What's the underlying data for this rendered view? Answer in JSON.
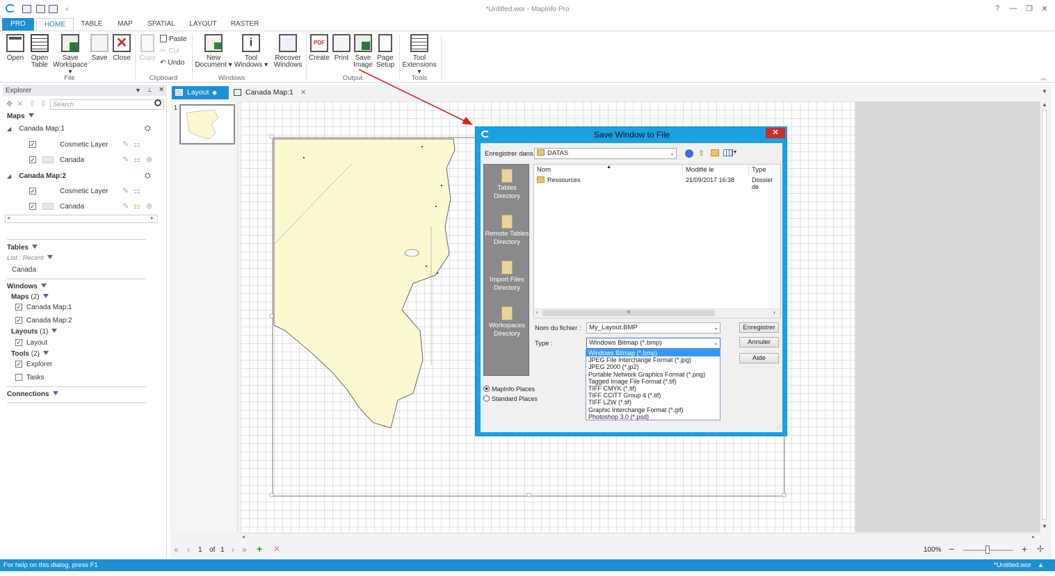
{
  "app": {
    "title": "*Untitled.wor - MapInfo Pro",
    "help": "?",
    "minimize": "—",
    "restore": "❐",
    "close": "✕"
  },
  "tabs": [
    "PRO",
    "HOME",
    "TABLE",
    "MAP",
    "SPATIAL",
    "LAYOUT",
    "RASTER"
  ],
  "ribbon": {
    "file": {
      "open": "Open",
      "open_table": [
        "Open",
        "Table"
      ],
      "save_workspace": [
        "Save",
        "Workspace ▾"
      ],
      "save": "Save",
      "close": "Close",
      "group": "File"
    },
    "clipboard": {
      "copy": "Copy",
      "paste": "Paste",
      "cut": "Cut",
      "undo": "Undo",
      "group": "Clipboard"
    },
    "windows": {
      "new_document": [
        "New",
        "Document ▾"
      ],
      "tool_windows": [
        "Tool",
        "Windows ▾"
      ],
      "recover_windows": [
        "Recover",
        "Windows"
      ],
      "group": "Windows"
    },
    "output": {
      "create": "Create",
      "print": "Print",
      "save_image": [
        "Save",
        "Image"
      ],
      "page_setup": [
        "Page",
        "Setup"
      ],
      "group": "Output"
    },
    "tools": {
      "tool_extensions": [
        "Tool",
        "Extensions ▾"
      ],
      "group": "Tools"
    }
  },
  "explorer": {
    "title": "Explorer",
    "search_placeholder": "Search",
    "maps_label": "Maps",
    "maps": [
      {
        "name": "Canada Map:1",
        "layers": [
          "Cosmetic Layer",
          "Canada"
        ]
      },
      {
        "name": "Canada Map:2",
        "layers": [
          "Cosmetic Layer",
          "Canada"
        ]
      }
    ],
    "tables_label": "Tables",
    "tables_list": "List : Recent",
    "tables": [
      "Canada"
    ],
    "windows_label": "Windows",
    "win_maps": "Maps",
    "win_maps_count": "(2)",
    "win_maps_items": [
      "Canada Map:1",
      "Canada Map:2"
    ],
    "win_layouts": "Layouts",
    "win_layouts_count": "(1)",
    "win_layouts_items": [
      "Layout"
    ],
    "win_tools": "Tools",
    "win_tools_count": "(2)",
    "win_tools_items": [
      "Explorer",
      "Tasks"
    ],
    "connections_label": "Connections"
  },
  "doc_tabs": [
    {
      "label": "Layout"
    },
    {
      "label": "Canada Map:1"
    }
  ],
  "thumb_page": "1",
  "dialog": {
    "title": "Save Window to File",
    "save_in_label": "Enregistrer dans :",
    "save_in_value": "DATAS",
    "places": [
      "Tables Directory",
      "Remote Tables Directory",
      "Import Files Directory",
      "Workspaces Directory"
    ],
    "columns": [
      "Nom",
      "Modifié le",
      "Type"
    ],
    "files": [
      {
        "name": "Ressources",
        "modified": "21/09/2017 16:38",
        "type": "Dossier de"
      }
    ],
    "filename_label": "Nom du fichier :",
    "filename_value": "My_Layout.BMP",
    "type_label": "Type :",
    "type_value": "Windows Bitmap (*.bmp)",
    "type_options": [
      "Windows Bitmap (*.bmp)",
      "JPEG File Interchange Format (*.jpg)",
      "JPEG 2000 (*.jp2)",
      "Portable Network Graphics Format (*.png)",
      "Tagged Image File Format (*.tif)",
      "TIFF CMYK (*.tif)",
      "TIFF CCITT Group 4 (*.tif)",
      "TIFF LZW (*.tif)",
      "Graphic Interchange Format (*.gif)",
      "Photoshop 3.0 (*.psd)"
    ],
    "buttons": {
      "save": "Enregistrer",
      "cancel": "Annuler",
      "help": "Aide"
    },
    "radio": {
      "mapinfo": "MapInfo Places",
      "standard": "Standard Places"
    },
    "scroll_mid": "III"
  },
  "bottom": {
    "page": "1",
    "of": "of",
    "total": "1",
    "zoom": "100%"
  },
  "status": {
    "left": "For help on this dialog, press F1",
    "right": "*Untitled.wor"
  },
  "colors": {
    "accent": "#1f8fd3",
    "dialog_frame": "#1ba1e2",
    "map_fill": "#fbf8d2",
    "arrow": "#e01b1b",
    "close_red": "#c7302b"
  }
}
